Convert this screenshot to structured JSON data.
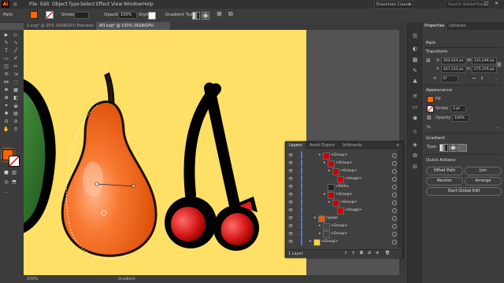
{
  "app": {
    "logo": "Ai",
    "home_icon": "home-icon"
  },
  "menu": [
    "File",
    "Edit",
    "Object",
    "Type",
    "Select",
    "Effect",
    "View",
    "Window",
    "Help"
  ],
  "workspace": {
    "label": "Essentials Classic",
    "dropdown": "▾"
  },
  "search": {
    "placeholder": "Search Adobe Stock"
  },
  "window_buttons": {
    "minimize": "–",
    "maximize": "□",
    "close": "✕"
  },
  "control_bar": {
    "selection_label": "Path",
    "stroke_label": "Stroke:",
    "opacity_label": "Opacity:",
    "opacity_value": "100%",
    "style_label": "Style:",
    "gradient_type_label": "Gradient Type:",
    "fill_color": "#ff6600"
  },
  "doc_tabs": [
    {
      "label": "1.svg* @ 25% (RGB/GPU Preview)",
      "close": "×",
      "active": false
    },
    {
      "label": "AЛ.svg* @ 150% (RGB/GPU Preview)",
      "close": "×",
      "active": true
    }
  ],
  "tools": [
    "▶",
    "▷",
    "✎",
    "T",
    "✐",
    "╱",
    "▭",
    "✂",
    "⟲",
    "⇲",
    "▦",
    "◒",
    "⊞",
    "✦",
    "⚲",
    "✥",
    "⊕",
    "▤",
    "◧",
    "≡",
    "⊡",
    "⊗",
    "…"
  ],
  "colors": {
    "artboard": "#ffe066",
    "accent_orange": "#ff6600",
    "selection_blue": "#4f7bd9"
  },
  "layers_panel": {
    "tabs": [
      "Layers",
      "Asset Export",
      "Artboards"
    ],
    "rows": [
      {
        "label": "<Group>",
        "indent": 3
      },
      {
        "label": "<Group>",
        "indent": 4
      },
      {
        "label": "<Group>",
        "indent": 5
      },
      {
        "label": "<Image>",
        "indent": 6
      },
      {
        "label": "<Path>",
        "indent": 4
      },
      {
        "label": "<Group>",
        "indent": 4
      },
      {
        "label": "<Group>",
        "indent": 5
      },
      {
        "label": "<Image>",
        "indent": 6
      },
      {
        "label": "груша",
        "indent": 2
      },
      {
        "label": "<Group>",
        "indent": 3
      },
      {
        "label": "<Group>",
        "indent": 3
      },
      {
        "label": "<Group>",
        "indent": 1
      }
    ],
    "footer_count": "1 Layer"
  },
  "properties_panel": {
    "tabs": [
      "Properties",
      "Libraries"
    ],
    "path_title": "Path",
    "transform_title": "Transform",
    "x_label": "X:",
    "x_value": "202,424 px",
    "y_label": "Y:",
    "y_value": "447,133 px",
    "w_label": "W:",
    "w_value": "131,248 px",
    "h_label": "H:",
    "h_value": "275,379 px",
    "angle_value": "0°",
    "appearance_title": "Appearance",
    "fill_label": "Fill",
    "stroke_label": "Stroke",
    "stroke_value": "3 pt",
    "opacity_label": "Opacity",
    "opacity_value": "100%",
    "fx_label": "fx.",
    "gradient_title": "Gradient",
    "gradient_type_label": "Type:",
    "quick_actions_title": "Quick Actions",
    "buttons": [
      "Offset Path",
      "Join",
      "Recolor",
      "Arrange",
      "Start Global Edit"
    ]
  },
  "status": {
    "zoom": "150%",
    "mode": "Gradient"
  }
}
